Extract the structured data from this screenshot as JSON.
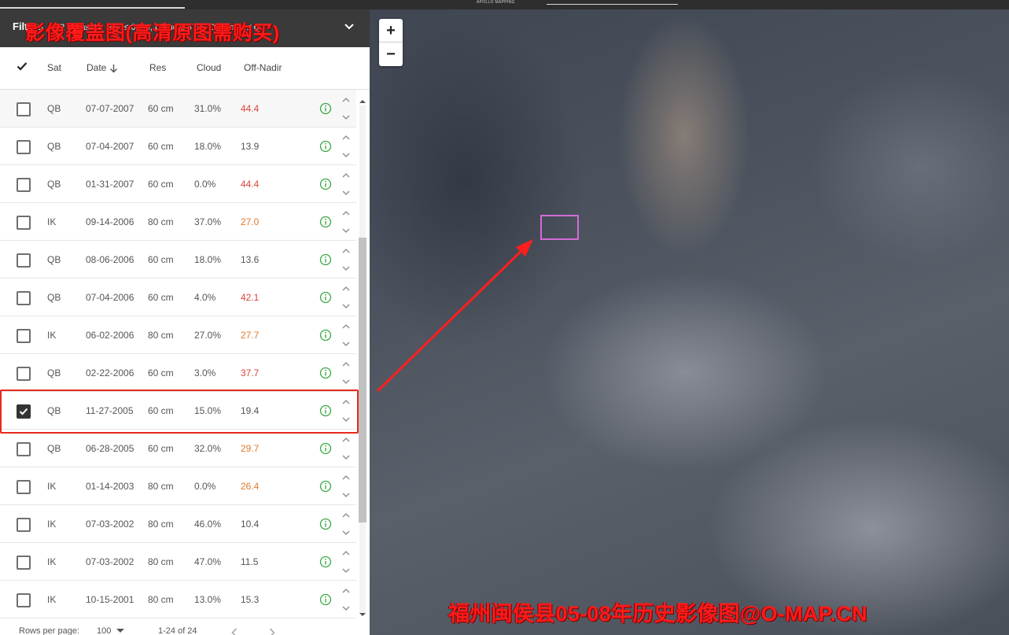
{
  "topbar": {
    "brand": "APOLLO MAPPING"
  },
  "filters": {
    "label": "Filters",
    "summary": "52 Datasets, Res ≤ 0.9m, Cloud ≤ 47%, Off-Nadir ≤ 60°"
  },
  "table": {
    "columns": {
      "sat": "Sat",
      "date": "Date",
      "res": "Res",
      "cloud": "Cloud",
      "nadir": "Off-Nadir"
    },
    "rows": [
      {
        "sat": "QB",
        "date": "07-07-2007",
        "res": "60 cm",
        "cloud": "31.0%",
        "nadir": "44.4",
        "nadir_level": "red",
        "checked": false
      },
      {
        "sat": "QB",
        "date": "07-04-2007",
        "res": "60 cm",
        "cloud": "18.0%",
        "nadir": "13.9",
        "nadir_level": "normal",
        "checked": false
      },
      {
        "sat": "QB",
        "date": "01-31-2007",
        "res": "60 cm",
        "cloud": "0.0%",
        "nadir": "44.4",
        "nadir_level": "red",
        "checked": false
      },
      {
        "sat": "IK",
        "date": "09-14-2006",
        "res": "80 cm",
        "cloud": "37.0%",
        "nadir": "27.0",
        "nadir_level": "orange",
        "checked": false
      },
      {
        "sat": "QB",
        "date": "08-06-2006",
        "res": "60 cm",
        "cloud": "18.0%",
        "nadir": "13.6",
        "nadir_level": "normal",
        "checked": false
      },
      {
        "sat": "QB",
        "date": "07-04-2006",
        "res": "60 cm",
        "cloud": "4.0%",
        "nadir": "42.1",
        "nadir_level": "red",
        "checked": false
      },
      {
        "sat": "IK",
        "date": "06-02-2006",
        "res": "80 cm",
        "cloud": "27.0%",
        "nadir": "27.7",
        "nadir_level": "orange",
        "checked": false
      },
      {
        "sat": "QB",
        "date": "02-22-2006",
        "res": "60 cm",
        "cloud": "3.0%",
        "nadir": "37.7",
        "nadir_level": "red",
        "checked": false
      },
      {
        "sat": "QB",
        "date": "11-27-2005",
        "res": "60 cm",
        "cloud": "15.0%",
        "nadir": "19.4",
        "nadir_level": "normal",
        "checked": true
      },
      {
        "sat": "QB",
        "date": "06-28-2005",
        "res": "60 cm",
        "cloud": "32.0%",
        "nadir": "29.7",
        "nadir_level": "orange",
        "checked": false
      },
      {
        "sat": "IK",
        "date": "01-14-2003",
        "res": "80 cm",
        "cloud": "0.0%",
        "nadir": "26.4",
        "nadir_level": "orange",
        "checked": false
      },
      {
        "sat": "IK",
        "date": "07-03-2002",
        "res": "80 cm",
        "cloud": "46.0%",
        "nadir": "10.4",
        "nadir_level": "normal",
        "checked": false
      },
      {
        "sat": "IK",
        "date": "07-03-2002",
        "res": "80 cm",
        "cloud": "47.0%",
        "nadir": "11.5",
        "nadir_level": "normal",
        "checked": false
      },
      {
        "sat": "IK",
        "date": "10-15-2001",
        "res": "80 cm",
        "cloud": "13.0%",
        "nadir": "15.3",
        "nadir_level": "normal",
        "checked": false
      }
    ]
  },
  "footer": {
    "rows_per_page_label": "Rows per page:",
    "rows_per_page_value": "100",
    "range": "1-24 of 24"
  },
  "map": {
    "zoom_in": "+",
    "zoom_out": "−"
  },
  "watermarks": {
    "top": "影像覆盖图(高清原图需购买)",
    "bottom": "福州闽侯县05-08年历史影像图@O-MAP.CN"
  },
  "colors": {
    "highlight": "#e8291c",
    "footprint": "#d36bd8",
    "info_icon": "#3aa845",
    "nadir_red": "#d9443b",
    "nadir_orange": "#e07a2c"
  }
}
